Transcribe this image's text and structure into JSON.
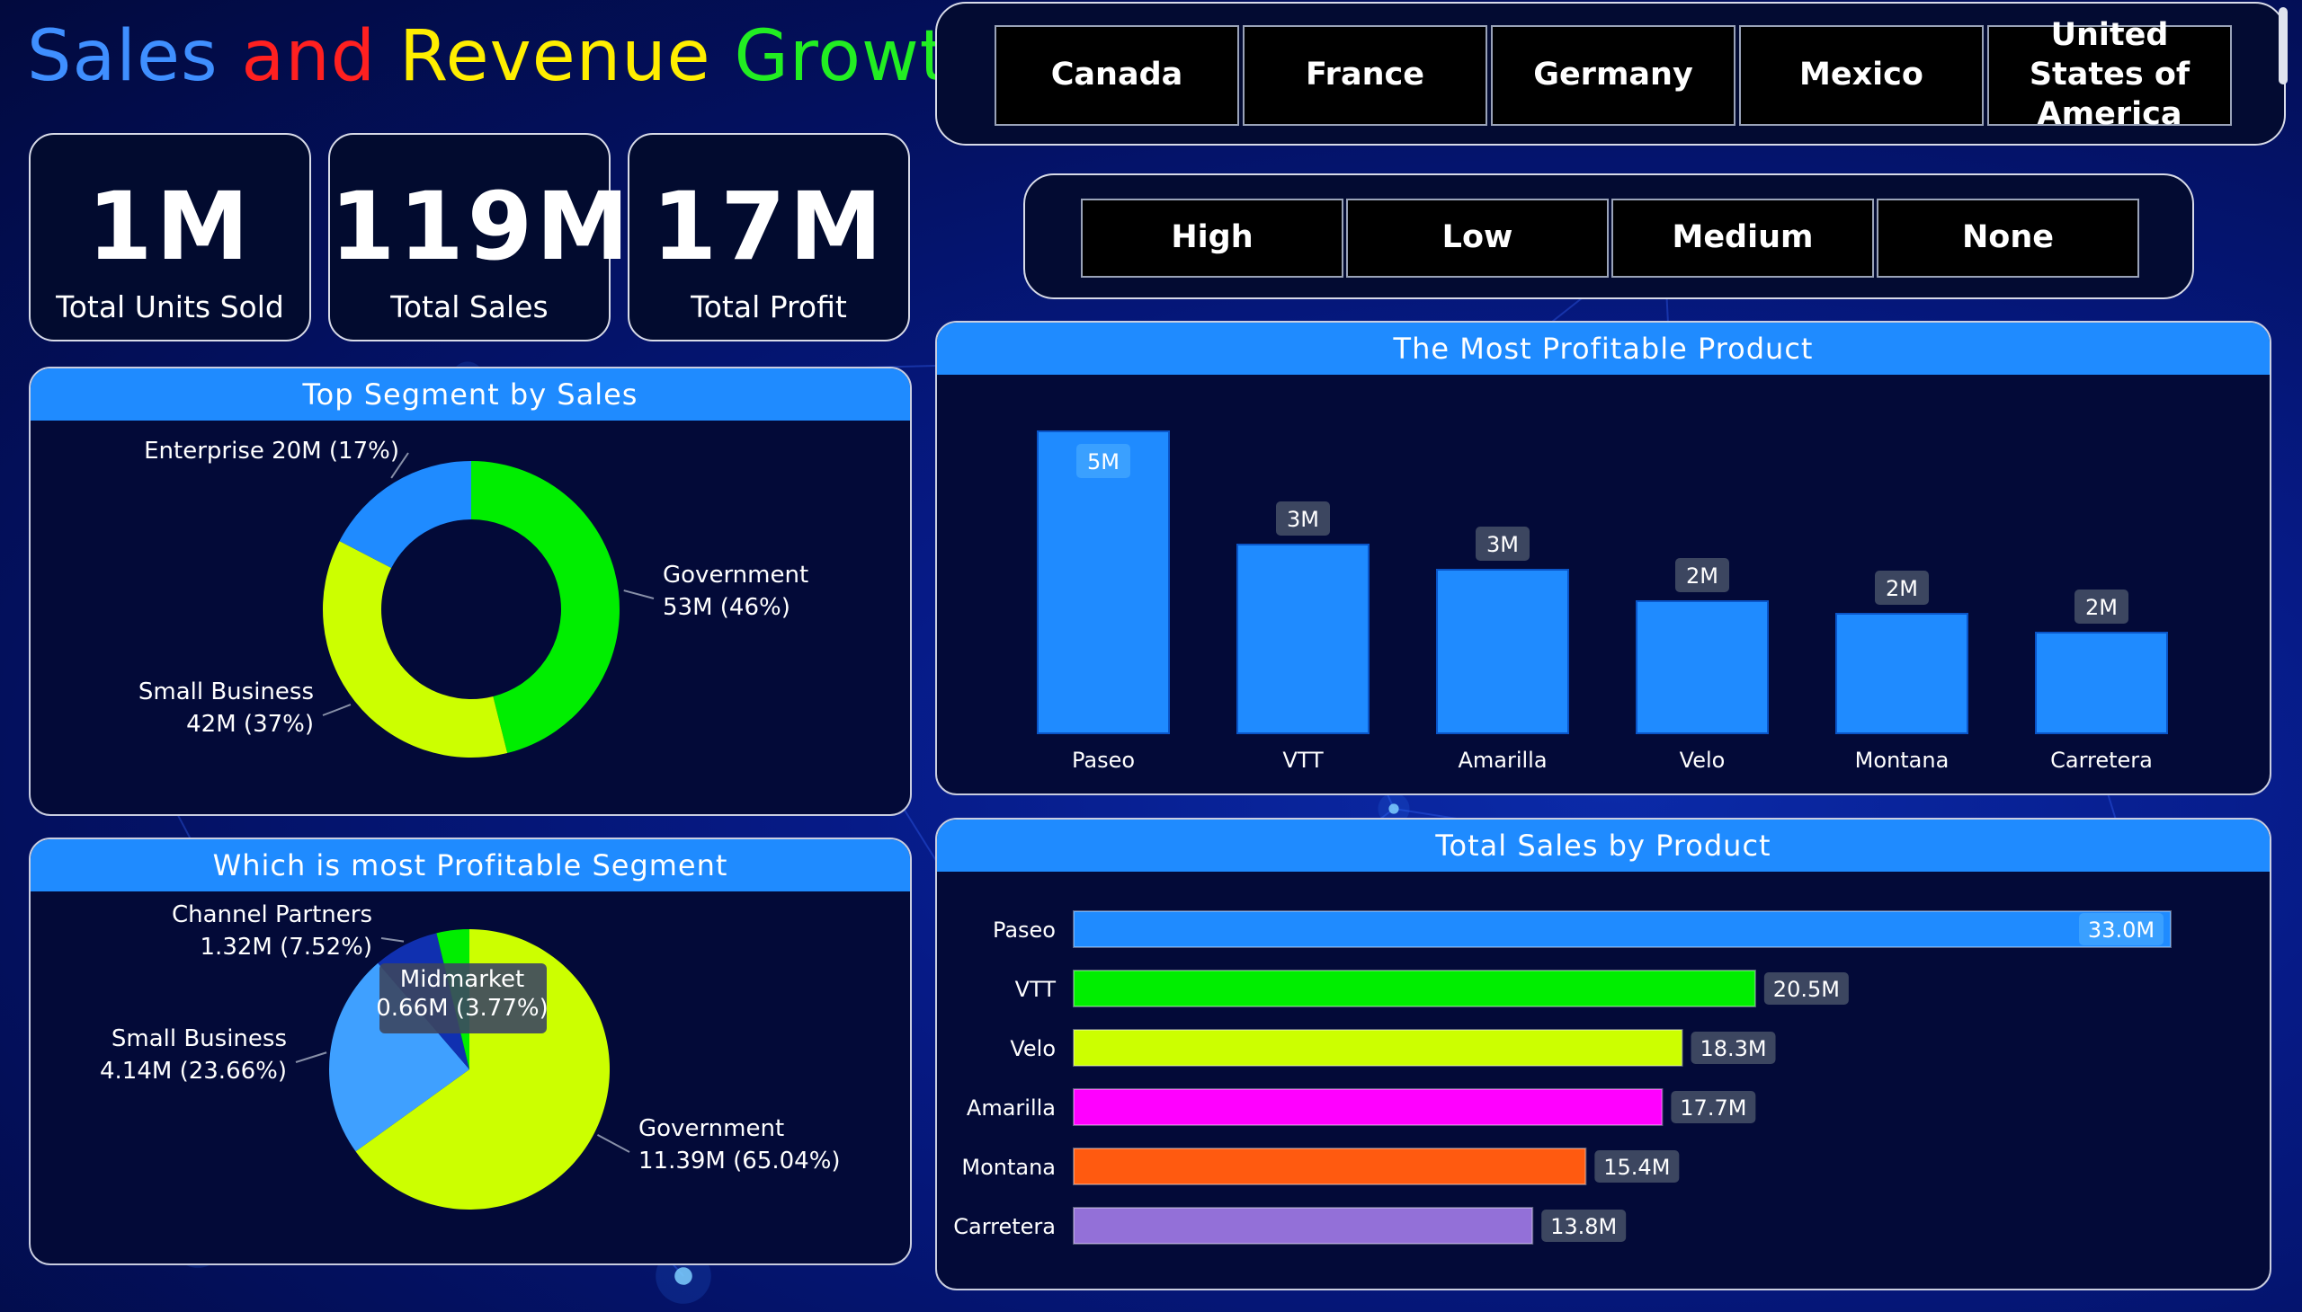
{
  "header": {
    "title_words": [
      {
        "text": "Sales",
        "color": "#3f8fff"
      },
      {
        "text": "and",
        "color": "#ff2020"
      },
      {
        "text": "Revenue",
        "color": "#ffee00"
      },
      {
        "text": "Growth",
        "color": "#22ee22"
      }
    ]
  },
  "kpis": [
    {
      "value": "1M",
      "label": "Total Units Sold"
    },
    {
      "value": "119M",
      "label": "Total Sales"
    },
    {
      "value": "17M",
      "label": "Total Profit"
    }
  ],
  "country_slicer": [
    "Canada",
    "France",
    "Germany",
    "Mexico",
    "United States of America"
  ],
  "discount_slicer": [
    "High",
    "Low",
    "Medium",
    "None"
  ],
  "chart_data": [
    {
      "type": "pie",
      "variant": "donut",
      "title": "Top Segment by Sales",
      "slices": [
        {
          "name": "Government",
          "value": 53,
          "percent": 46,
          "label": "53M (46%)",
          "color": "#00ee00"
        },
        {
          "name": "Small Business",
          "value": 42,
          "percent": 37,
          "label": "42M (37%)",
          "color": "#ccff00"
        },
        {
          "name": "Enterprise",
          "value": 20,
          "percent": 17,
          "label": "20M (17%)",
          "color": "#1f8bff"
        }
      ]
    },
    {
      "type": "pie",
      "title": "Which is most Profitable Segment",
      "slices": [
        {
          "name": "Government",
          "value": 11.39,
          "percent": 65.04,
          "label": "11.39M (65.04%)",
          "color": "#ccff00"
        },
        {
          "name": "Small Business",
          "value": 4.14,
          "percent": 23.66,
          "label": "4.14M (23.66%)",
          "color": "#3fa0ff"
        },
        {
          "name": "Channel Partners",
          "value": 1.32,
          "percent": 7.52,
          "label": "1.32M (7.52%)",
          "color": "#1030b0"
        },
        {
          "name": "Midmarket",
          "value": 0.66,
          "percent": 3.77,
          "label": "0.66M (3.77%)",
          "color": "#00ee00"
        }
      ]
    },
    {
      "type": "bar",
      "orientation": "vertical",
      "title": "The Most Profitable Product",
      "categories": [
        "Paseo",
        "VTT",
        "Amarilla",
        "Velo",
        "Montana",
        "Carretera"
      ],
      "values": [
        4.8,
        3.0,
        2.6,
        2.1,
        1.9,
        1.6
      ],
      "data_labels": [
        "5M",
        "3M",
        "3M",
        "2M",
        "2M",
        "2M"
      ],
      "ylim": [
        0,
        5
      ],
      "color": "#1f8bff",
      "grid": false
    },
    {
      "type": "bar",
      "orientation": "horizontal",
      "title": "Total Sales by Product",
      "categories": [
        "Paseo",
        "VTT",
        "Velo",
        "Amarilla",
        "Montana",
        "Carretera"
      ],
      "values": [
        33.0,
        20.5,
        18.3,
        17.7,
        15.4,
        13.8
      ],
      "data_labels": [
        "33.0M",
        "20.5M",
        "18.3M",
        "17.7M",
        "15.4M",
        "13.8M"
      ],
      "colors": [
        "#1f8bff",
        "#00ee00",
        "#ccff00",
        "#ff00ff",
        "#ff5a10",
        "#9370d8"
      ],
      "xlim": [
        0,
        33
      ],
      "grid": false
    }
  ]
}
